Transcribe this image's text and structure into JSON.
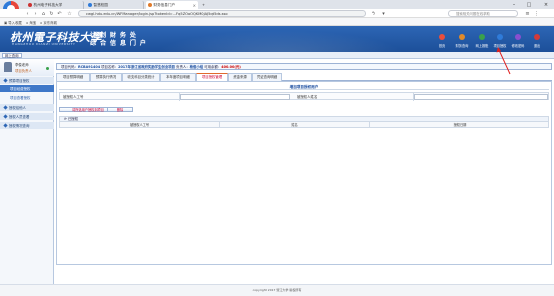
{
  "browser": {
    "tabs": [
      {
        "label": "杭州电子科技大学",
        "active": false
      },
      {
        "label": "智慧校园",
        "active": false
      },
      {
        "label": "财务信息门户",
        "active": true
      }
    ],
    "url": "cwgl.hdu.edu.cn/WFManager/login.jsp?tokenId=...Fq5ZOoOQKM0jAJ5qt5ds.sso",
    "search_placeholder": "搜索相关问题在线求助",
    "bookmarks": [
      "导入收藏",
      "淘宝",
      "京东商城"
    ]
  },
  "header": {
    "brand_cn": "杭州電子科技大學",
    "brand_en": "HANGZHOU DIANZI UNIVERSITY",
    "system_line1": "计 划 财 务 处",
    "system_line2": "综 合 信 息 门 户",
    "buttons": [
      {
        "label": "首页",
        "icon": "home-icon",
        "color": "#e94e3c"
      },
      {
        "label": "财务查询",
        "icon": "query-icon",
        "color": "#e08a2a"
      },
      {
        "label": "网上报账",
        "icon": "reimburse-icon",
        "color": "#3aa14b"
      },
      {
        "label": "项目授权",
        "icon": "authorize-icon",
        "color": "#2f7bd9"
      },
      {
        "label": "修改密码",
        "icon": "password-icon",
        "color": "#8a4fcf"
      },
      {
        "label": "退出",
        "icon": "logout-icon",
        "color": "#d33a3a"
      }
    ]
  },
  "subbar": {
    "label": "网上查询"
  },
  "sidebar": {
    "user_name": "李俊老师",
    "user_role": "项目负责人",
    "menu": [
      {
        "label": "预算项目授权",
        "type": "group"
      },
      {
        "label": "项目经费授权",
        "type": "sub",
        "selected": true
      },
      {
        "label": "项目查看授权",
        "type": "sub"
      },
      {
        "label": "授权给他人",
        "type": "group"
      },
      {
        "label": "授权人员查看",
        "type": "group"
      },
      {
        "label": "授权情况查询",
        "type": "group"
      }
    ]
  },
  "project_bar": {
    "code_label": "项目代码：",
    "code": "RCBA91404",
    "name_label": "项目名称：",
    "name": "2017年浙江省政府奖励学生创业项目",
    "leader_label": "负责人：",
    "leader": "杨俊小组",
    "amount_label": "可用余额：",
    "amount": "400.00(元)"
  },
  "project_tabs": [
    "项目预算明细",
    "预算执行情况",
    "收支科目分类统计",
    "本年度项目明细",
    "项目授权管理",
    "资金来源",
    "凭证查询明细"
  ],
  "active_tab_index": 4,
  "panel": {
    "title": "增加项目授权用户",
    "field1_label": "被授权人工号",
    "field1_value": "",
    "field2_label": "被授权人姓名",
    "field2_value": "",
    "add_button": "将所选用户授权到项目",
    "delete_button": "删除",
    "list_label": "已授权",
    "columns": [
      "被授权人工号",
      "姓名",
      "授权日期"
    ]
  },
  "footer": {
    "text": "copyright 2017 浙江大学 版权所有"
  }
}
